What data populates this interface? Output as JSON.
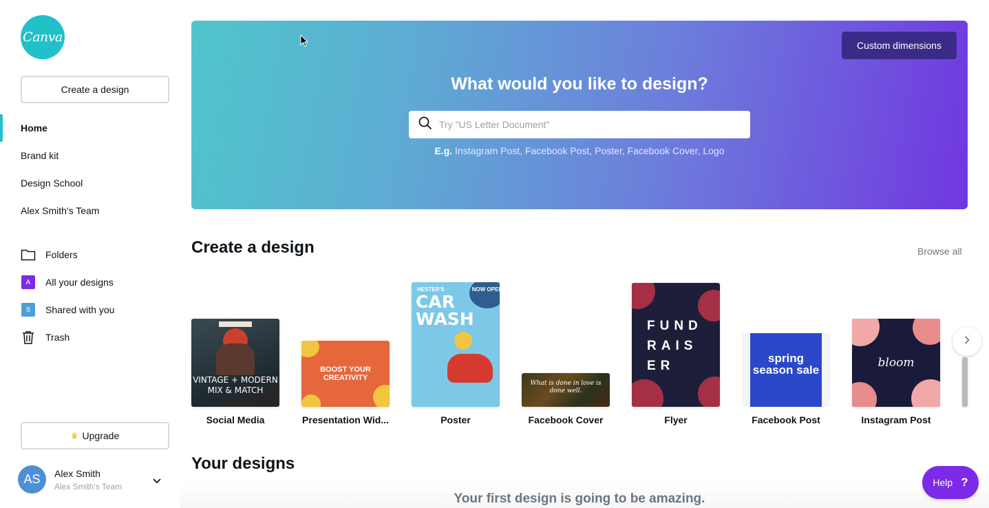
{
  "brand": {
    "logo_text": "Canva",
    "accent": "#22c0c9",
    "purple": "#7d2ae8"
  },
  "sidebar": {
    "create_label": "Create a design",
    "nav": [
      {
        "label": "Home",
        "active": true
      },
      {
        "label": "Brand kit"
      },
      {
        "label": "Design School"
      },
      {
        "label": "Alex Smith's Team"
      }
    ],
    "folders": [
      {
        "label": "Folders",
        "icon": "folder-icon"
      },
      {
        "label": "All your designs",
        "icon": "badge-a-icon",
        "badge": "A"
      },
      {
        "label": "Shared with you",
        "icon": "badge-s-icon",
        "badge": "S"
      },
      {
        "label": "Trash",
        "icon": "trash-icon"
      }
    ],
    "upgrade_label": "Upgrade",
    "user": {
      "initials": "AS",
      "name": "Alex Smith",
      "team": "Alex Smith's Team"
    }
  },
  "hero": {
    "custom_dimensions": "Custom dimensions",
    "title": "What would you like to design?",
    "search_placeholder": "Try \"US Letter Document\"",
    "examples_prefix": "E.g.",
    "examples": [
      "Instagram Post",
      "Facebook Post",
      "Poster",
      "Facebook Cover",
      "Logo"
    ]
  },
  "create_section": {
    "title": "Create a design",
    "browse_all": "Browse all",
    "cards": [
      {
        "label": "Social Media",
        "thumb_text": "VINTAGE + MODERN MIX & MATCH"
      },
      {
        "label": "Presentation Wid...",
        "thumb_text": "BOOST YOUR CREATIVITY"
      },
      {
        "label": "Poster",
        "thumb_text": "CAR WASH",
        "thumb_sub": "HESTER'S",
        "badge": "NOW OPEN"
      },
      {
        "label": "Facebook Cover",
        "thumb_text": "What is done in love is done well."
      },
      {
        "label": "Flyer",
        "thumb_text": "FUND RAIS ER"
      },
      {
        "label": "Facebook Post",
        "thumb_text": "spring season sale"
      },
      {
        "label": "Instagram Post",
        "thumb_text": "bloom"
      }
    ]
  },
  "your_designs": {
    "title": "Your designs",
    "empty_text": "Your first design is going to be amazing."
  },
  "help": {
    "label": "Help",
    "symbol": "?"
  }
}
